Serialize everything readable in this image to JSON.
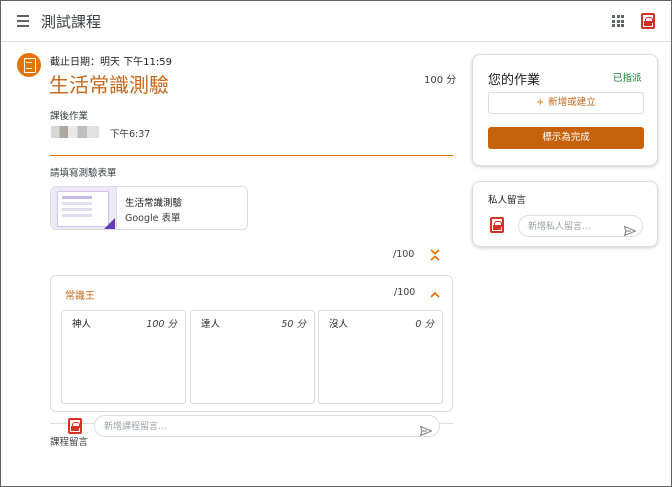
{
  "header": {
    "menu_icon": "hamburger-menu-icon",
    "title": "測試課程",
    "apps_icon": "apps-grid-icon",
    "account_icon": "account-avatar-icon"
  },
  "assignment": {
    "icon": "assignment-icon",
    "due": "截止日期：明天 下午11:59",
    "title": "生活常識測驗",
    "points": "100 分",
    "type_label": "課後作業",
    "posted_time": "下午6:37",
    "form_prompt": "請填寫測驗表單",
    "attachment": {
      "name": "生活常識測驗",
      "type": "Google 表單",
      "thumb_icon": "google-forms-thumbnail"
    },
    "total_score": "/100",
    "expand_icon": "unfold-more-icon"
  },
  "rubric": {
    "criterion": "常識王",
    "score": "/100",
    "collapse_icon": "chevron-up-icon",
    "levels": [
      {
        "name": "神人",
        "points": "100 分"
      },
      {
        "name": "達人",
        "points": "50 分"
      },
      {
        "name": "沒人",
        "points": "0 分"
      }
    ]
  },
  "class_comments": {
    "label": "課程留言",
    "placeholder": "新增課程留言...",
    "send_icon": "send-icon"
  },
  "your_work": {
    "title": "您的作業",
    "status": "已指派",
    "add_button": "新增或建立",
    "add_icon": "plus-icon",
    "mark_done_button": "標示為完成"
  },
  "private_comments": {
    "label": "私人留言",
    "placeholder": "新增私人留言...",
    "send_icon": "send-icon"
  },
  "colors": {
    "accent": "#e37400",
    "title_orange": "#c5681c",
    "done_button": "#c5620b",
    "assigned_green": "#188038",
    "avatar_red": "#d93025"
  }
}
